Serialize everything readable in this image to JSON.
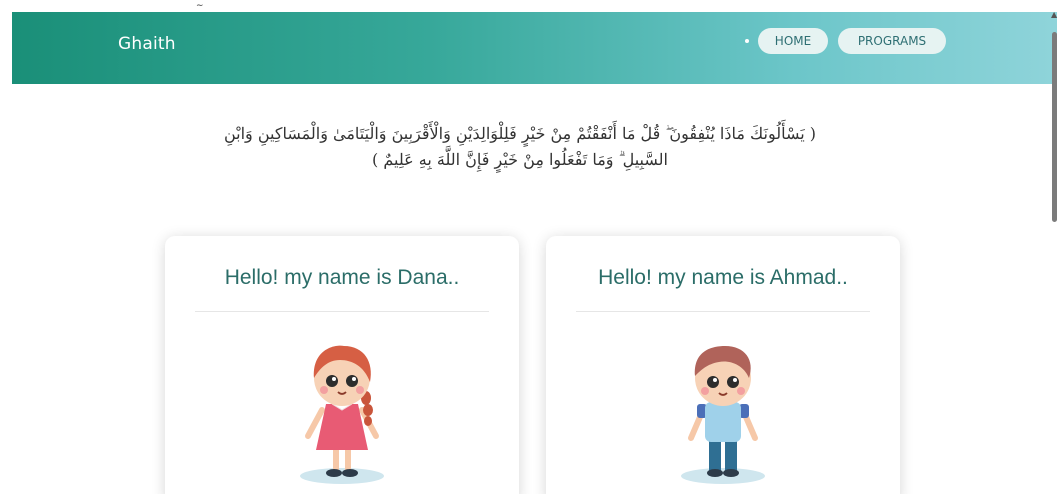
{
  "app": {
    "brand": "Ghaith"
  },
  "nav": {
    "items": [
      {
        "label": "HOME"
      },
      {
        "label": "PROGRAMS"
      }
    ]
  },
  "verse": {
    "text": "( يَسْأَلُونَكَ مَاذَا يُنْفِقُونَ ۖ قُلْ مَا أَنْفَقْتُمْ مِنْ خَيْرٍ فَلِلْوَالِدَيْنِ وَالْأَقْرَبِينَ وَالْيَتَامَىٰ وَالْمَسَاكِينِ وَابْنِ السَّبِيلِ ۗ وَمَا تَفْعَلُوا مِنْ خَيْرٍ فَإِنَّ اللَّهَ بِهِ عَلِيمٌ )"
  },
  "cards": [
    {
      "title": "Hello! my name is Dana..",
      "avatar": "girl-avatar"
    },
    {
      "title": "Hello! my name is Ahmad..",
      "avatar": "boy-avatar"
    }
  ],
  "colors": {
    "nav_gradient_start": "#1a8f78",
    "nav_gradient_end": "#8fd4da",
    "pill_bg": "#e6f3f2",
    "pill_text": "#2e6f73",
    "card_title": "#2b6d68"
  }
}
